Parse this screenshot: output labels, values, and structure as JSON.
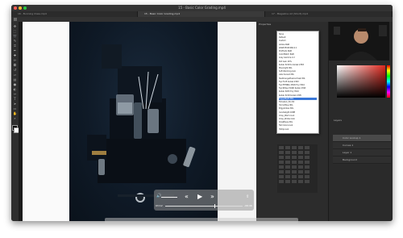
{
  "window": {
    "title": "15 - Basic Color Grading.mp4"
  },
  "tabs": [
    {
      "label": "16 - Bunning Class.mp4"
    },
    {
      "label": "15 - Basic Color Grading.mp4"
    },
    {
      "label": "17 - Magazine Ad (Short).mp4"
    }
  ],
  "colors": {
    "traffic_close": "#ff5f57",
    "traffic_min": "#ffbd2e",
    "traffic_max": "#28c840",
    "selection": "#3b78d8"
  },
  "player": {
    "current_time": "03:12",
    "remaining_time": "-06:46",
    "progress": 0.64
  },
  "panels": {
    "properties_label": "Properties",
    "layers_label": "Layers"
  },
  "dropdown": {
    "items": [
      "None",
      "Default",
      "Custom",
      "Adobe RGB",
      "sRGB IEC61966-2.1",
      "ProPhoto RGB",
      "ColorMatch RGB",
      "Gray Gamma 2.2",
      "Dot Gain 20%",
      "Kodak 5218 to Kodak 2383",
      "Moonlight.3DL",
      "Soft Warming.look",
      "Late Sunset.3DL",
      "TealOrangePlusContrast.3DL",
      "Fuji F125 Kodak 2393",
      "Fuji ETERNA 250D Fuji 3510",
      "Fuji REALA 500D Kodak 2393",
      "Kodak 5205 Fuji 3510",
      "Kodak 5218 Kodak 2395",
      "FoggyNight.3DL",
      "Filmstock_50.3dl",
      "HorrorBlue.3DL",
      "EdgyAmber.3DL",
      "Candlelight.CUBE",
      "Crisp_Warm.look",
      "Crisp_Winter.look",
      "DropBlues.3DL",
      "Fall Colors.look",
      "3Strip.look"
    ],
    "selected_index": 19
  },
  "layers": {
    "rows": [
      "Color Lookup 1",
      "Curves 1",
      "Layer 1",
      "Background"
    ]
  },
  "toolbar": {
    "icons": [
      "move-icon",
      "marquee-icon",
      "lasso-icon",
      "quick-select-icon",
      "crop-icon",
      "eyedropper-icon",
      "healing-icon",
      "brush-icon",
      "stamp-icon",
      "history-brush-icon",
      "eraser-icon",
      "gradient-icon",
      "blur-icon",
      "dodge-icon",
      "pen-icon",
      "type-icon",
      "path-select-icon",
      "shape-icon",
      "hand-icon",
      "zoom-icon"
    ]
  }
}
